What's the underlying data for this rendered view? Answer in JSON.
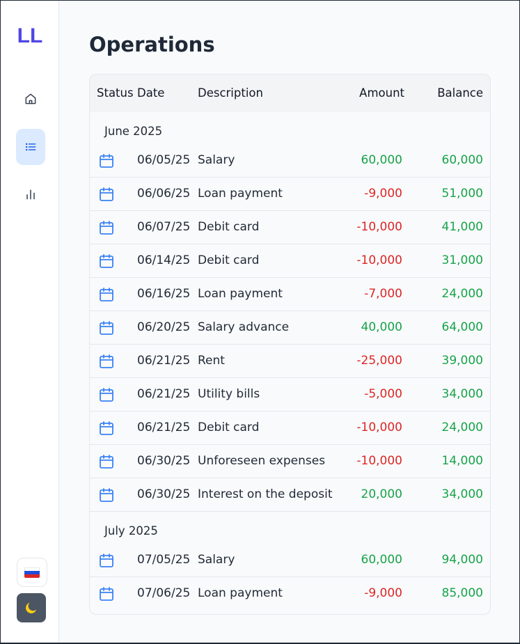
{
  "app": {
    "logo": "LL"
  },
  "sidebar": {
    "items": [
      {
        "name": "home",
        "icon": "home-icon",
        "active": false
      },
      {
        "name": "operations",
        "icon": "list-icon",
        "active": true
      },
      {
        "name": "charts",
        "icon": "bar-chart-icon",
        "active": false
      }
    ],
    "language_icon": "russia-flag-icon",
    "theme_icon": "moon-icon"
  },
  "page": {
    "title": "Operations"
  },
  "table": {
    "headers": {
      "status": "Status",
      "date": "Date",
      "description": "Description",
      "amount": "Amount",
      "balance": "Balance"
    },
    "groups": [
      {
        "month": "June 2025",
        "rows": [
          {
            "date": "06/05/25",
            "description": "Salary",
            "amount": "60,000",
            "balance": "60,000"
          },
          {
            "date": "06/06/25",
            "description": "Loan payment",
            "amount": "-9,000",
            "balance": "51,000"
          },
          {
            "date": "06/07/25",
            "description": "Debit card",
            "amount": "-10,000",
            "balance": "41,000"
          },
          {
            "date": "06/14/25",
            "description": "Debit card",
            "amount": "-10,000",
            "balance": "31,000"
          },
          {
            "date": "06/16/25",
            "description": "Loan payment",
            "amount": "-7,000",
            "balance": "24,000"
          },
          {
            "date": "06/20/25",
            "description": "Salary advance",
            "amount": "40,000",
            "balance": "64,000"
          },
          {
            "date": "06/21/25",
            "description": "Rent",
            "amount": "-25,000",
            "balance": "39,000"
          },
          {
            "date": "06/21/25",
            "description": "Utility bills",
            "amount": "-5,000",
            "balance": "34,000"
          },
          {
            "date": "06/21/25",
            "description": "Debit card",
            "amount": "-10,000",
            "balance": "24,000"
          },
          {
            "date": "06/30/25",
            "description": "Unforeseen expenses",
            "amount": "-10,000",
            "balance": "14,000"
          },
          {
            "date": "06/30/25",
            "description": "Interest on the deposit",
            "amount": "20,000",
            "balance": "34,000"
          }
        ]
      },
      {
        "month": "July 2025",
        "rows": [
          {
            "date": "07/05/25",
            "description": "Salary",
            "amount": "60,000",
            "balance": "94,000"
          },
          {
            "date": "07/06/25",
            "description": "Loan payment",
            "amount": "-9,000",
            "balance": "85,000"
          }
        ]
      }
    ]
  },
  "colors": {
    "accent": "#4f46e5",
    "icon_blue": "#3b82f6",
    "positive": "#16a34a",
    "negative": "#dc2626"
  }
}
